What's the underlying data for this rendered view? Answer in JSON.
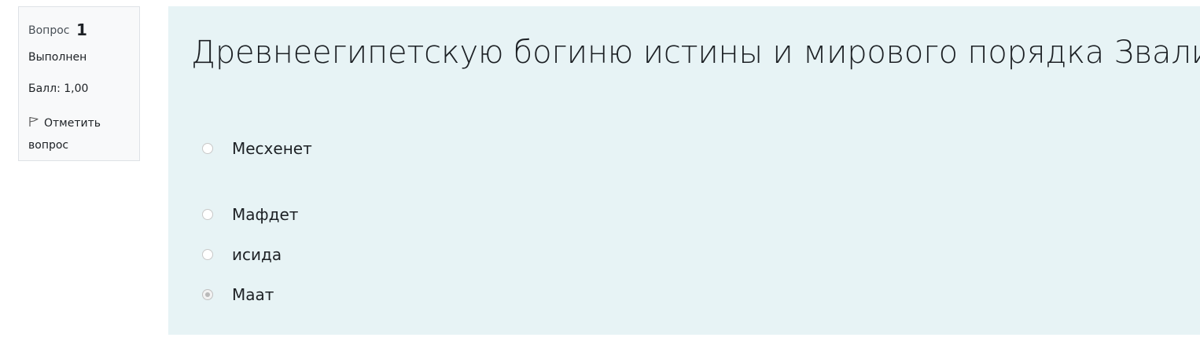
{
  "info": {
    "question_prefix": "Вопрос",
    "question_number": "1",
    "state": "Выполнен",
    "grade": "Балл: 1,00",
    "flag_label": "Отметить вопрос"
  },
  "question": {
    "text": "Древнеегипетскую богиню истины и мирового порядка Звали",
    "answers": [
      {
        "label": "Месхенет",
        "selected": false
      },
      {
        "label": "Мафдет",
        "selected": false
      },
      {
        "label": "исида",
        "selected": false
      },
      {
        "label": "Маат",
        "selected": true
      }
    ]
  }
}
